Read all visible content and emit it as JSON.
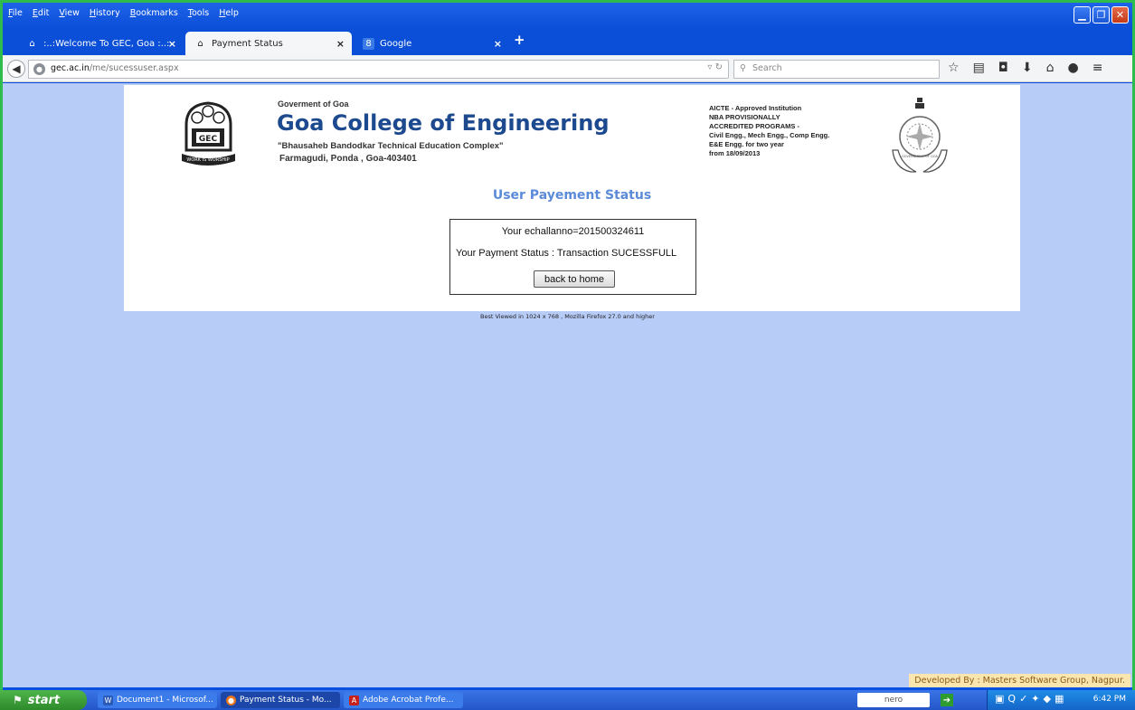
{
  "menu": [
    "File",
    "Edit",
    "View",
    "History",
    "Bookmarks",
    "Tools",
    "Help"
  ],
  "tabs": [
    {
      "label": ":..:Welcome To GEC, Goa :..:",
      "close": "×"
    },
    {
      "label": "Payment Status",
      "close": "×"
    },
    {
      "label": "Google",
      "close": "×"
    }
  ],
  "nav": {
    "url_domain": "gec.ac.in",
    "url_path": "/me/sucessuser.aspx",
    "search_placeholder": "Search"
  },
  "header": {
    "govt": "Goverment of Goa",
    "college": "Goa College of Engineering",
    "complex": "\"Bhausaheb Bandodkar Technical Education Complex\"",
    "address": "Farmagudi, Ponda , Goa-403401",
    "logo_text": "GEC",
    "logo_motto": "WORK IS WORSHIP",
    "accreditation": [
      "AICTE - Approved Institution",
      "NBA PROVISIONALLY",
      "ACCREDITED PROGRAMS -",
      "Civil Engg., Mech Engg., Comp Engg.",
      "E&E Engg. for two year",
      "from 18/09/2013"
    ],
    "emblem_text": "GOVERNMENT OF GOA"
  },
  "page": {
    "title": "User Payement Status",
    "challan": "Your echallanno=201500324611",
    "payment_status": "Your Payment Status :   Transaction SUCESSFULL",
    "home_button": "back to home",
    "best_viewed": "Best Viewed in 1024 x 768 , Mozilla Firefox 27.0 and higher",
    "developer": "Developed By : Masters Software Group, Nagpur."
  },
  "taskbar": {
    "start": "start",
    "tasks": [
      "Document1 - Microsof...",
      "Payment Status - Mo...",
      "Adobe Acrobat Profe..."
    ],
    "nero": "nero",
    "time": "6:42 PM"
  },
  "colors": {
    "viewport_bg": "#b8ccf8",
    "title_blue": "#5b8bd8",
    "college_blue": "#1d4a8f",
    "frame_green": "#2ebd4c"
  }
}
